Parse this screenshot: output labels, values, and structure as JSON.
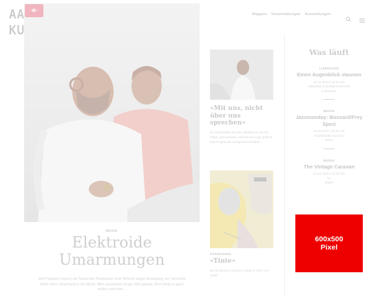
{
  "logo": {
    "line1": "AA",
    "line2": "KU"
  },
  "nav": {
    "items": [
      "Magazin",
      "Veranstaltungen",
      "Ausstellungen"
    ],
    "search_icon": "search-icon",
    "menu_icon": "hamburger-menu-icon"
  },
  "hero": {
    "kicker": "MUSIK",
    "title_line1": "Elektroide",
    "title_line2": "Umarmungen",
    "teaser": "Stell Happiest Figuren die Tanzenden Musikanten Ihrer Bühnen zeigen Bewegung, der Tanzende findet seine Umarmung in der Musik. Alles zusammen ist gar nicht gebaut, doch klingt es ganz anders und leise…"
  },
  "cards": [
    {
      "title": "«Mit uns, nicht über uns sprechen»",
      "text": "Die Kunsthalle und das Stadtarchiv als Ort, Pläne, gemeinsame Zukunft ins Auge gefasst. Das Projekt der Dorfgemeinschaften…"
    },
    {
      "kicker": "FORSCHUNG",
      "title": "«Tinte»",
      "text": "Die Illustratorin und ihre Arbeit in Tinte und Feder"
    }
  ],
  "events": {
    "heading": "Was läuft",
    "items": [
      {
        "category": "LITERATUR",
        "name": "Einen Augenblick staunen",
        "meta": [
          "22.10.2023 | 19:30 Uhr",
          "Bibliothek & Dorfgemeinschaft",
          "Kulturhaus"
        ]
      },
      {
        "category": "MUSIK",
        "name": "Jazzmonday: Bossard/Frey Spezi",
        "meta": [
          "24.10.2023 | 20:30 Uhr",
          "Kleintheater Kaserne",
          "Basel"
        ]
      },
      {
        "category": "MUSIK",
        "name": "The Vintage Caravan",
        "meta": [
          "24.10.2023 | 19:30 Uhr",
          "Z7",
          "Basel"
        ]
      }
    ]
  },
  "ad": {
    "line1": "600x500",
    "line2": "Pixel",
    "color": "#ee0000"
  }
}
